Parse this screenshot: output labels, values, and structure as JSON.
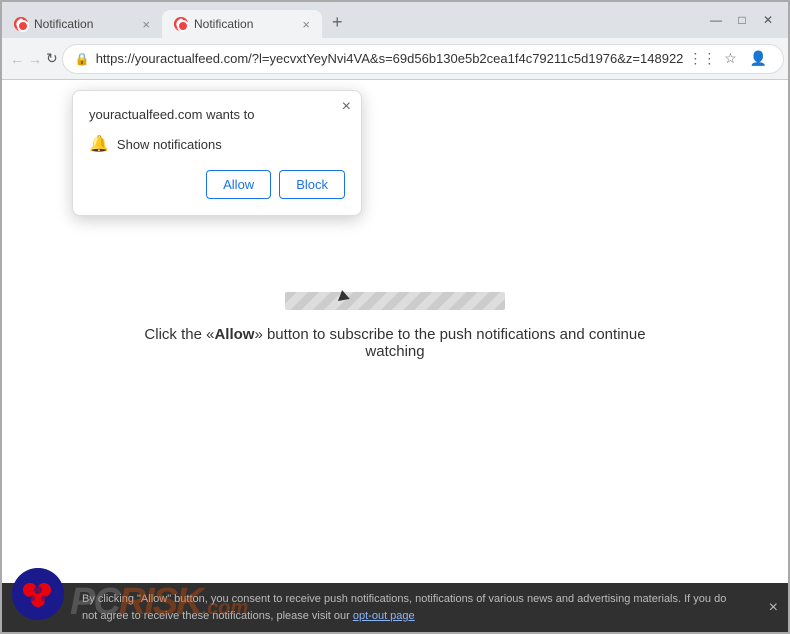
{
  "browser": {
    "tabs": [
      {
        "label": "Notification",
        "active": false,
        "favicon": "notification-favicon"
      },
      {
        "label": "Notification",
        "active": true,
        "favicon": "notification-favicon"
      }
    ],
    "new_tab_label": "+",
    "url": "https://youractualfeed.com/?l=yecvxtYeyNvi4VA&s=69d56b130e5b2cea1f4c79211c5d1976&z=148922",
    "window_controls": {
      "minimize": "—",
      "maximize": "□",
      "close": "✕"
    }
  },
  "notification_popup": {
    "title": "youractualfeed.com wants to",
    "notification_option": "Show notifications",
    "allow_label": "Allow",
    "block_label": "Block",
    "close_label": "×"
  },
  "page": {
    "instruction": "Click the «Allow» button to subscribe to the push notifications and continue watching",
    "instruction_bold_part": "Allow"
  },
  "bottom_bar": {
    "text_before_link": "By clicking \"Allow\" button, you consent to receive push notifications, notifications of various news and advertising materials. If you do not agree to receive these notifications, please visit our ",
    "link_text": "opt-out page",
    "close_label": "×"
  },
  "pc_risk": {
    "pc_text": "PC",
    "risk_text": "RISK",
    "dot_com": ".com"
  }
}
